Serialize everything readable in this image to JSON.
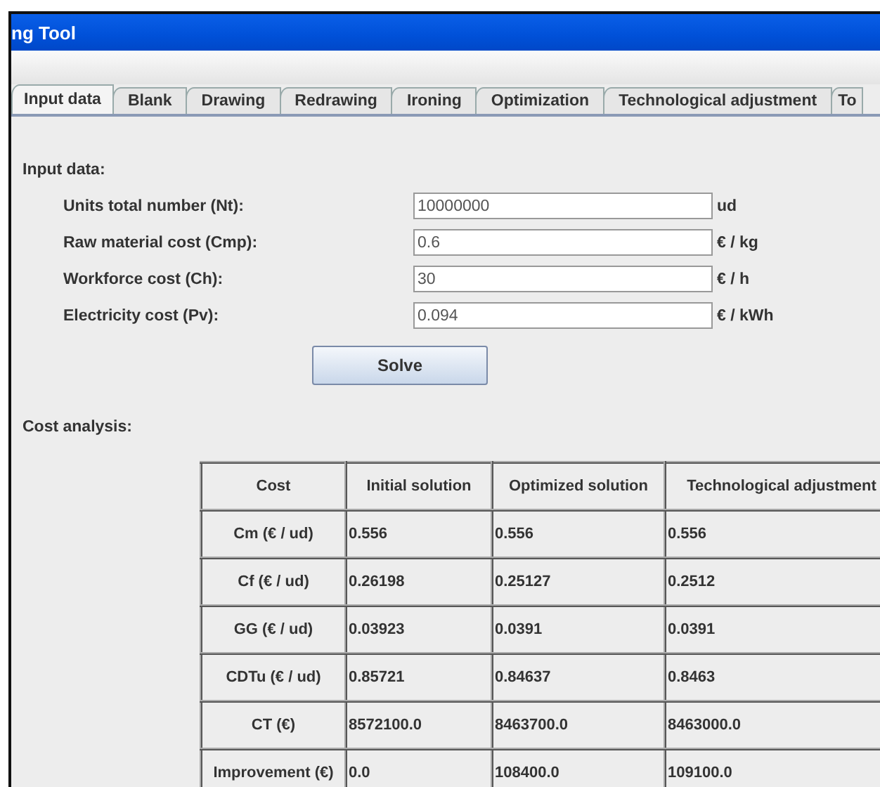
{
  "window": {
    "title": "ng Tool"
  },
  "tabs": [
    {
      "label": "Input data",
      "selected": true
    },
    {
      "label": "Blank",
      "selected": false
    },
    {
      "label": "Drawing",
      "selected": false
    },
    {
      "label": "Redrawing",
      "selected": false
    },
    {
      "label": "Ironing",
      "selected": false
    },
    {
      "label": "Optimization",
      "selected": false
    },
    {
      "label": "Technological adjustment",
      "selected": false
    },
    {
      "label": "To",
      "selected": false
    }
  ],
  "input_section": {
    "title": "Input data:",
    "fields": [
      {
        "label": "Units total number (Nt):",
        "value": "10000000",
        "unit": "ud"
      },
      {
        "label": "Raw material cost (Cmp):",
        "value": "0.6",
        "unit": "€ / kg"
      },
      {
        "label": "Workforce cost (Ch):",
        "value": "30",
        "unit": "€ / h"
      },
      {
        "label": "Electricity cost (Pv):",
        "value": "0.094",
        "unit": "€ / kWh"
      }
    ],
    "solve_button": "Solve"
  },
  "cost_analysis": {
    "title": "Cost analysis:",
    "columns": [
      "Cost",
      "Initial solution",
      "Optimized solution",
      "Technological adjustment"
    ],
    "rows": [
      [
        "Cm (€ / ud)",
        "0.556",
        "0.556",
        "0.556"
      ],
      [
        "Cf (€ / ud)",
        "0.26198",
        "0.25127",
        "0.2512"
      ],
      [
        "GG (€ / ud)",
        "0.03923",
        "0.0391",
        "0.0391"
      ],
      [
        "CDTu (€ / ud)",
        "0.85721",
        "0.84637",
        "0.8463"
      ],
      [
        "CT (€)",
        "8572100.0",
        "8463700.0",
        "8463000.0"
      ],
      [
        "Improvement (€)",
        "0.0",
        "108400.0",
        "109100.0"
      ]
    ]
  }
}
